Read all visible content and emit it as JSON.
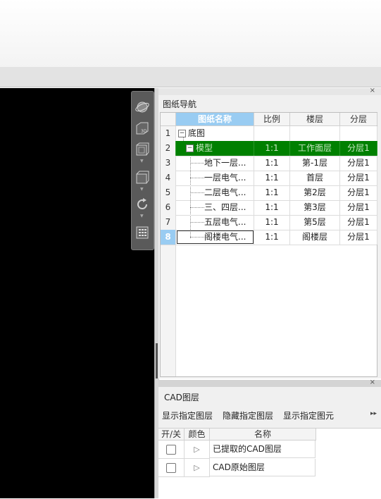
{
  "drawing_nav": {
    "title": "图纸导航",
    "close": "×",
    "columns": [
      "图纸名称",
      "比例",
      "楼层",
      "分层"
    ],
    "rows": [
      {
        "num": "1",
        "name": "底图",
        "scale": "",
        "floor": "",
        "layer": "",
        "expander": "−"
      },
      {
        "num": "2",
        "name": "模型",
        "scale": "1:1",
        "floor": "工作面层",
        "layer": "分层1",
        "expander": "−"
      },
      {
        "num": "3",
        "name": "地下一层...",
        "scale": "1:1",
        "floor": "第-1层",
        "layer": "分层1"
      },
      {
        "num": "4",
        "name": "一层电气...",
        "scale": "1:1",
        "floor": "首层",
        "layer": "分层1"
      },
      {
        "num": "5",
        "name": "二层电气...",
        "scale": "1:1",
        "floor": "第2层",
        "layer": "分层1"
      },
      {
        "num": "6",
        "name": "三、四层...",
        "scale": "1:1",
        "floor": "第3层",
        "layer": "分层1"
      },
      {
        "num": "7",
        "name": "五层电气...",
        "scale": "1:1",
        "floor": "第5层",
        "layer": "分层1"
      },
      {
        "num": "8",
        "name": "阁楼电气...",
        "scale": "1:1",
        "floor": "阁楼层",
        "layer": "分层1"
      }
    ]
  },
  "view_toolbar": {
    "tools": [
      "orbit-icon",
      "3d-view-icon",
      "cube-view-icon",
      "box-view-icon",
      "rotate-icon",
      "calculator-icon"
    ],
    "cube_sublabel": "3D"
  },
  "cad_layers": {
    "title": "CAD图层",
    "close": "×",
    "actions": [
      "显示指定图层",
      "隐藏指定图层",
      "显示指定图元"
    ],
    "more": "▸▸",
    "columns": [
      "开/关",
      "颜色",
      "名称"
    ],
    "rows": [
      {
        "name": "已提取的CAD图层",
        "checked": false
      },
      {
        "name": "CAD原始图层",
        "checked": false
      }
    ]
  }
}
